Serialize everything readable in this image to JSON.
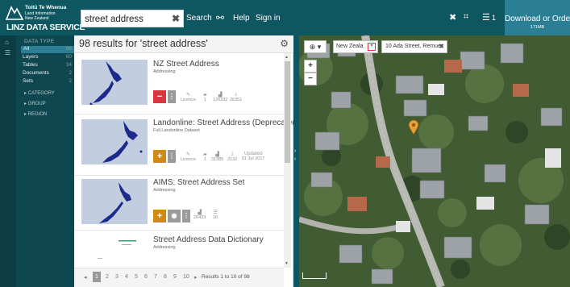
{
  "header": {
    "logo_line1": "Toitū Te Whenua",
    "logo_line2": "Land Information New Zealand",
    "logo_main": "LINZ DATA SERVICE",
    "search_value": "street address",
    "search_button": "Search",
    "help": "Help",
    "signin": "Sign in",
    "download_label": "Download or Order",
    "download_size": "171MB",
    "list_count": "1",
    "icons": [
      "link-icon",
      "close-icon",
      "crop-icon",
      "list-icon"
    ]
  },
  "sidebar": {
    "heading": "DATA TYPE",
    "items": [
      {
        "label": "All",
        "count": "98"
      },
      {
        "label": "Layers",
        "count": "60"
      },
      {
        "label": "Tables",
        "count": "34"
      },
      {
        "label": "Documents",
        "count": "2"
      },
      {
        "label": "Sets",
        "count": "2"
      }
    ],
    "filters": [
      "▸ CATEGORY",
      "▸ GROUP",
      "▸ REGION"
    ]
  },
  "results": {
    "title": "98 results for 'street address'",
    "items": [
      {
        "title": "NZ Street Address",
        "subtitle": "Addressing",
        "action": "remove",
        "stats": [
          {
            "icon": "licence",
            "value": "Licence"
          },
          {
            "icon": "comment",
            "value": "1"
          },
          {
            "icon": "chart",
            "value": "126332"
          },
          {
            "icon": "download",
            "value": "26351"
          }
        ]
      },
      {
        "title": "Landonline: Street Address (Deprecated)",
        "subtitle": "Full Landonline Dataset",
        "action": "add",
        "stats": [
          {
            "icon": "licence",
            "value": "Licence"
          },
          {
            "icon": "comment",
            "value": "1"
          },
          {
            "icon": "chart",
            "value": "31385"
          },
          {
            "icon": "download",
            "value": "2132"
          },
          {
            "icon": "updated",
            "value": "01 Jul 2017",
            "label": "Updated"
          }
        ]
      },
      {
        "title": "AIMS: Street Address Set",
        "subtitle": "Addressing",
        "action": "add",
        "stats": [
          {
            "icon": "chart",
            "value": "26433"
          },
          {
            "icon": "list",
            "value": "16"
          }
        ]
      },
      {
        "title": "Street Address Data Dictionary",
        "subtitle": "Addressing",
        "action": "none",
        "stats": []
      }
    ],
    "pages": [
      "1",
      "2",
      "3",
      "4",
      "5",
      "6",
      "7",
      "8",
      "9",
      "10"
    ],
    "status": "Results 1 to 10 of 98"
  },
  "map": {
    "zoom_in": "+",
    "zoom_out": "−",
    "search_mode": "🔍",
    "region_select": "New Zeala",
    "address_value": "10 Ada Street, Remuer",
    "marker_color": "#e8a13a"
  },
  "colors": {
    "header": "#0e5660",
    "nav": "#0e4750",
    "accent": "#2b7f94",
    "remove": "#d9363e",
    "add": "#d08a14"
  }
}
